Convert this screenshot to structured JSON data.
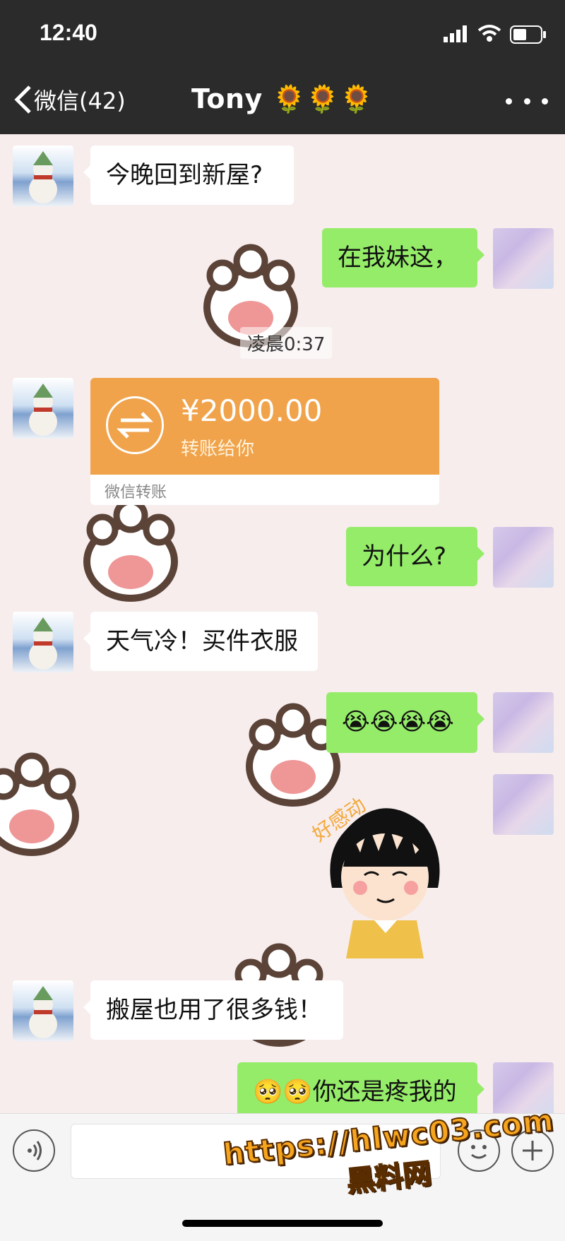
{
  "status_bar": {
    "time": "12:40"
  },
  "nav": {
    "back_label": "微信(42)",
    "title": "Tony 🌻🌻🌻"
  },
  "messages": [
    {
      "side": "in",
      "text": "今晚回到新屋?"
    },
    {
      "side": "out",
      "text": "在我妹这，"
    },
    {
      "side": "out",
      "text": "为什么?"
    },
    {
      "side": "in",
      "text": "天气冷！买件衣服"
    },
    {
      "side": "out",
      "text": "😭😭😭😭"
    },
    {
      "side": "in",
      "text": "搬屋也用了很多钱！"
    },
    {
      "side": "out",
      "text": "🥺🥺你还是疼我的"
    }
  ],
  "timestamp": "凌晨0:37",
  "transfer": {
    "amount": "¥2000.00",
    "note": "转账给你",
    "footer": "微信转账"
  },
  "sticker": {
    "caption": "好感动"
  },
  "watermark": {
    "url": "https://hlwc03.com",
    "name": "黑料网"
  },
  "colors": {
    "incoming_bubble": "#ffffff",
    "outgoing_bubble": "#95ec69",
    "transfer": "#f0a34b",
    "header": "#2b2b2b"
  }
}
